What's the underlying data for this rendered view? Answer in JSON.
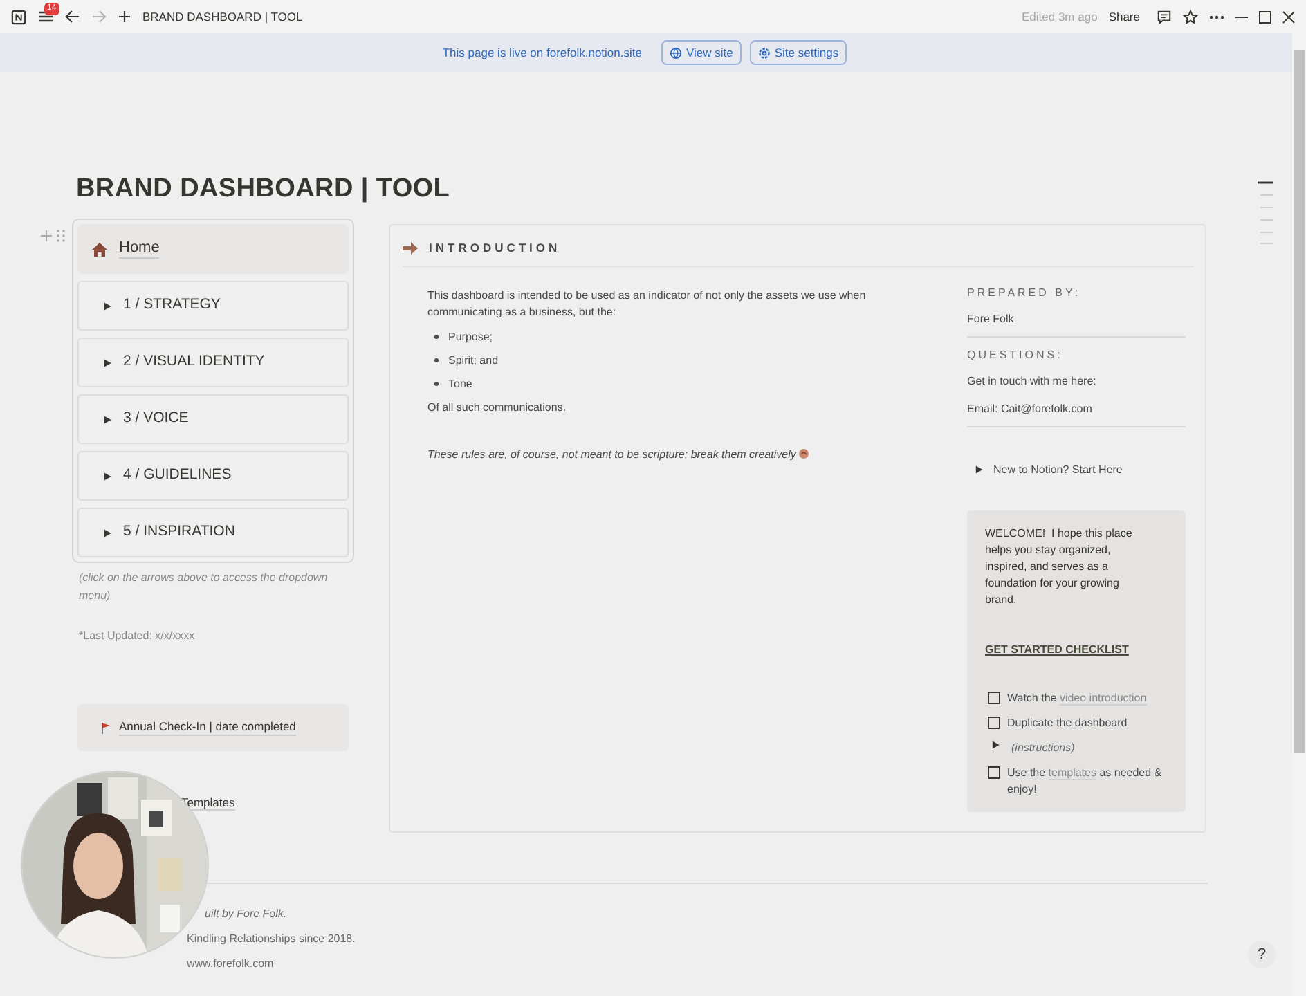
{
  "browser": {
    "badge": "14",
    "page_title": "BRAND DASHBOARD | TOOL",
    "edited": "Edited 3m ago",
    "share": "Share",
    "forward_disabled": true
  },
  "banner": {
    "message": "This page is live on forefolk.notion.site",
    "buttons": [
      "View site",
      "Site settings"
    ]
  },
  "title": "BRAND DASHBOARD | TOOL",
  "nav": {
    "home": "Home",
    "toggles": [
      {
        "label": "1 / STRATEGY",
        "expanded": false
      },
      {
        "label": "2 / VISUAL IDENTITY",
        "expanded": false
      },
      {
        "label": "3 / VOICE",
        "expanded": false
      },
      {
        "label": "4 / GUIDELINES",
        "expanded": false
      },
      {
        "label": "5 / INSPIRATION",
        "expanded": false
      }
    ],
    "caption": "(click on the arrows above to access the dropdown menu)",
    "last_updated": "*Last Updated: x/x/xxxx"
  },
  "check_in": "Annual Check-In | date completed",
  "templates_link": "Templates",
  "intro": {
    "heading": "INTRODUCTION",
    "paragraph": "This dashboard is intended to be used as an indicator of not only the assets we use when communicating as a business, but the:",
    "bullets": [
      "Purpose;",
      "Spirit; and",
      "Tone"
    ],
    "closing": "Of all such communications.",
    "note": "These rules are, of course, not meant to be scripture; break them creatively"
  },
  "aside": {
    "prepared_label": "PREPARED BY:",
    "prepared_by": "Fore Folk",
    "questions_label": "QUESTIONS:",
    "questions": [
      "Get in touch with me here:",
      "Email: Cait@forefolk.com"
    ],
    "toggle": {
      "label": "New to Notion? Start Here",
      "expanded": false
    }
  },
  "welcome": {
    "message": "WELCOME!  I hope this place helps you stay organized, inspired, and serves as a foundation for your growing brand.",
    "checklist_title": "GET STARTED CHECKLIST",
    "items": [
      {
        "kind": "todo",
        "checked": false,
        "text": "Watch the ",
        "link": "video introduction"
      },
      {
        "kind": "todo",
        "checked": false,
        "text": "Duplicate the dashboard"
      },
      {
        "kind": "toggle",
        "expanded": false,
        "text": "(instructions)"
      },
      {
        "kind": "todo",
        "checked": false,
        "text": "Use the ",
        "link": "templates",
        "after": " as needed & enjoy!"
      }
    ]
  },
  "footer": [
    "uilt by Fore Folk.",
    "Kindling Relationships since 2018.",
    "www.forefolk.com"
  ],
  "help": "?"
}
